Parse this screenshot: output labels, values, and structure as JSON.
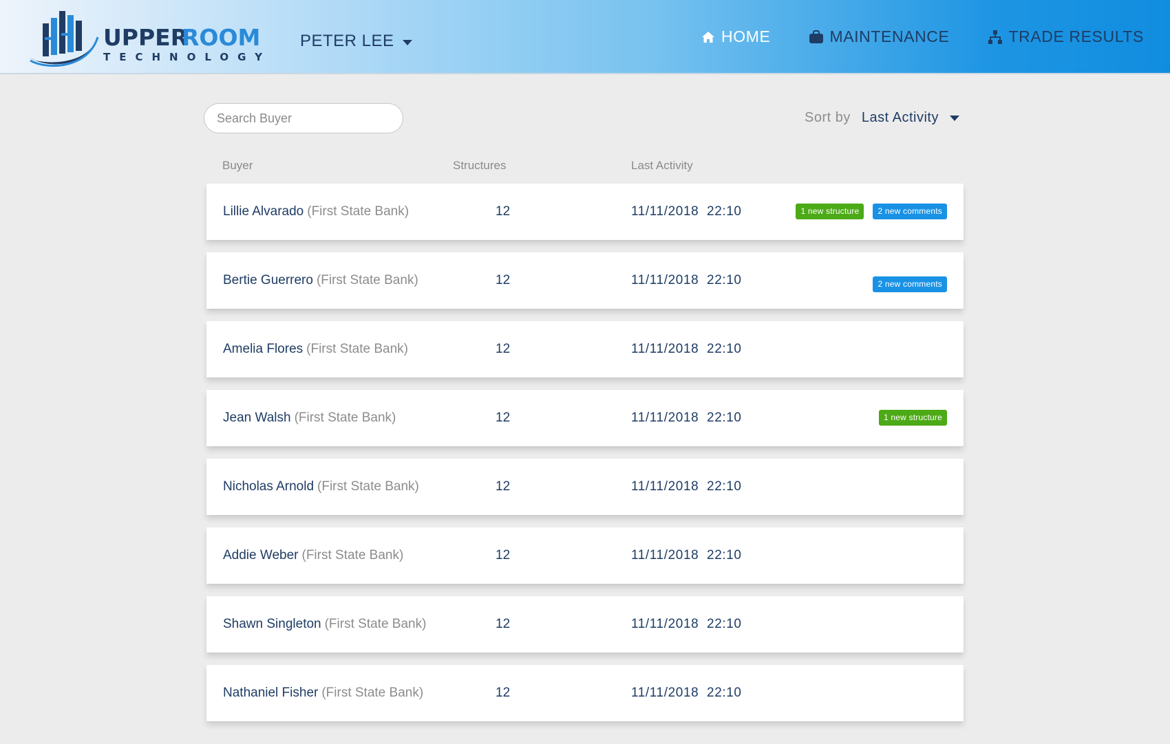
{
  "brand": {
    "name_part1": "UPPER",
    "name_part2": "ROOM",
    "tagline": "TECHNOLOGY"
  },
  "user_menu": {
    "label": "PETER LEE"
  },
  "nav": {
    "home": "HOME",
    "maintenance": "MAINTENANCE",
    "trade_results": "TRADE RESULTS"
  },
  "search": {
    "placeholder": "Search Buyer"
  },
  "sort": {
    "label": "Sort by",
    "value": "Last Activity"
  },
  "table": {
    "columns": {
      "buyer": "Buyer",
      "structures": "Structures",
      "last_activity": "Last Activity"
    },
    "rows": [
      {
        "name": "Lillie Alvarado",
        "bank": "(First State Bank)",
        "structures": "12",
        "date": "11/11/2018",
        "time": "22:10",
        "badge_structure": "1 new structure",
        "badge_comments": "2 new comments"
      },
      {
        "name": "Bertie Guerrero",
        "bank": "(First State Bank)",
        "structures": "12",
        "date": "11/11/2018",
        "time": "22:10",
        "badge_comments": "2 new comments"
      },
      {
        "name": "Amelia Flores",
        "bank": "(First State Bank)",
        "structures": "12",
        "date": "11/11/2018",
        "time": "22:10"
      },
      {
        "name": "Jean Walsh",
        "bank": "(First State Bank)",
        "structures": "12",
        "date": "11/11/2018",
        "time": "22:10",
        "badge_structure": "1 new structure"
      },
      {
        "name": "Nicholas Arnold",
        "bank": "(First State Bank)",
        "structures": "12",
        "date": "11/11/2018",
        "time": "22:10"
      },
      {
        "name": "Addie Weber",
        "bank": "(First State Bank)",
        "structures": "12",
        "date": "11/11/2018",
        "time": "22:10"
      },
      {
        "name": "Shawn Singleton",
        "bank": "(First State Bank)",
        "structures": "12",
        "date": "11/11/2018",
        "time": "22:10"
      },
      {
        "name": "Nathaniel Fisher",
        "bank": "(First State Bank)",
        "structures": "12",
        "date": "11/11/2018",
        "time": "22:10"
      }
    ]
  },
  "colors": {
    "navy": "#1f3c64",
    "accent_blue": "#1992e6",
    "badge_green": "#4caa16",
    "muted": "#8c8c8c",
    "background": "#ececec"
  },
  "icons": {
    "home": "home-icon",
    "maintenance": "briefcase-icon",
    "trade_results": "sitemap-icon"
  }
}
